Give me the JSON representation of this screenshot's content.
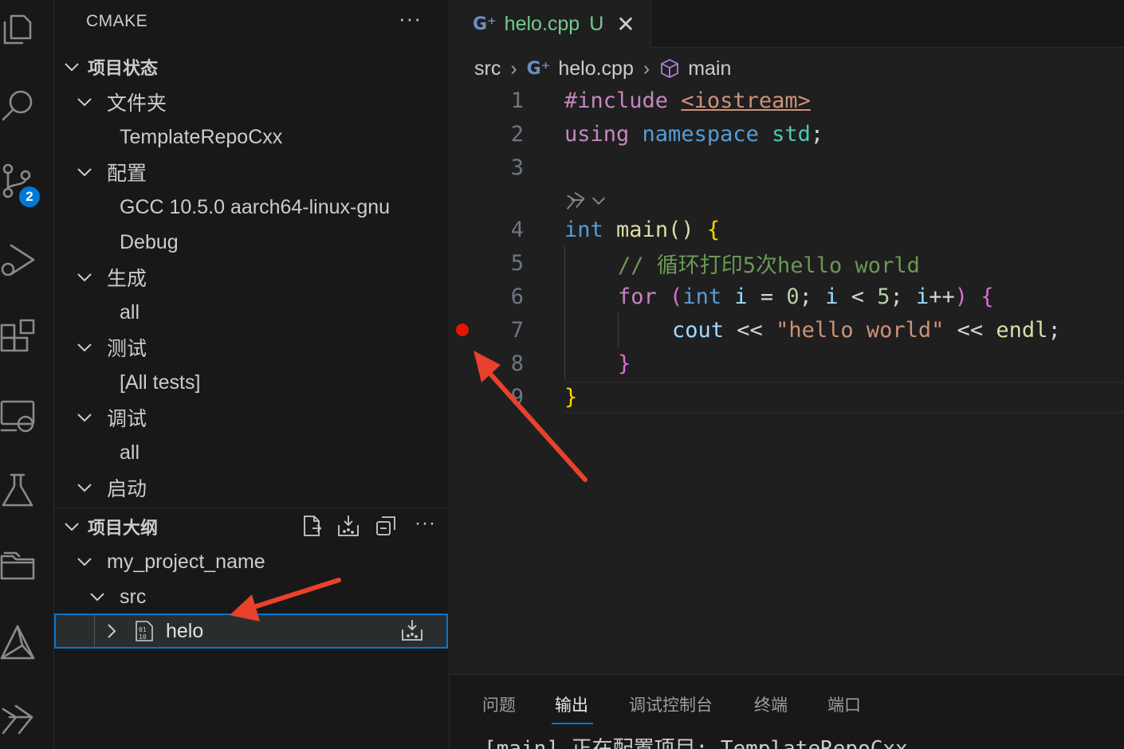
{
  "colors": {
    "accent": "#0078d4",
    "arrow": "#e8412c",
    "breakpoint": "#e51400",
    "modified_file": "#73c991"
  },
  "activity_bar": {
    "icons": [
      "explorer-icon",
      "search-icon",
      "source-control-icon",
      "run-debug-icon",
      "extensions-icon",
      "remote-explorer-icon",
      "testing-icon",
      "folder-icon",
      "cmake-icon",
      "copilot-icon"
    ],
    "source_control_badge": "2"
  },
  "sidebar": {
    "title": "CMAKE",
    "more": "···",
    "project_status": {
      "header": "项目状态",
      "folder_label": "文件夹",
      "folder_value": "TemplateRepoCxx",
      "config_label": "配置",
      "config_kit": "GCC 10.5.0 aarch64-linux-gnu",
      "config_type": "Debug",
      "build_label": "生成",
      "build_target": "all",
      "test_label": "测试",
      "test_target": "[All tests]",
      "debug_label": "调试",
      "debug_target": "all",
      "launch_label": "启动"
    },
    "outline": {
      "header": "项目大纲",
      "project": "my_project_name",
      "folder": "src",
      "target": "helo"
    }
  },
  "editor": {
    "tab": {
      "filename": "helo.cpp",
      "status": "U",
      "close": "✕"
    },
    "breadcrumb": {
      "folder": "src",
      "file": "helo.cpp",
      "symbol": "main"
    },
    "line_numbers": [
      "1",
      "2",
      "3",
      "4",
      "5",
      "6",
      "7",
      "8",
      "9"
    ],
    "code": {
      "l1_directive": "#include",
      "l1_header": "<iostream>",
      "l2_using": "using",
      "l2_namespace": "namespace",
      "l2_std": "std",
      "l2_semi": ";",
      "l4_int": "int",
      "l4_main": "main",
      "l4_parens": "()",
      "l4_brace": "{",
      "l5_comment": "// 循环打印5次hello world",
      "l6_for": "for",
      "l6_open": "(",
      "l6_int": "int",
      "l6_i1": "i",
      "l6_eq": " = ",
      "l6_zero": "0",
      "l6_semi1": "; ",
      "l6_i2": "i",
      "l6_lt": " < ",
      "l6_five": "5",
      "l6_semi2": "; ",
      "l6_i3": "i",
      "l6_inc": "++",
      "l6_close": ")",
      "l6_brace": "{",
      "l7_cout": "cout",
      "l7_op1": " << ",
      "l7_str": "\"hello world\"",
      "l7_op2": " << ",
      "l7_endl": "endl",
      "l7_semi": ";",
      "l8_brace": "}",
      "l9_brace": "}"
    },
    "breakpoint_line": 7
  },
  "panel": {
    "tabs": [
      "问题",
      "输出",
      "调试控制台",
      "终端",
      "端口"
    ],
    "active_tab": "输出",
    "output_line": "[main] 正在配置项目: TemplateRepoCxx"
  }
}
